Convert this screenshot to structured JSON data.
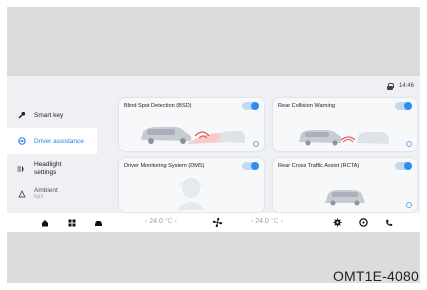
{
  "status": {
    "time": "14:46",
    "lock_icon": "lock-icon"
  },
  "sidebar": {
    "items": [
      {
        "label": "Smart key",
        "icon": "key-icon",
        "active": false
      },
      {
        "label": "Driver assistance",
        "icon": "driver-assist-icon",
        "active": true
      },
      {
        "label": "Headlight settings",
        "icon": "headlight-icon",
        "active": false
      },
      {
        "label": "Ambient",
        "sub": "light",
        "icon": "ambient-icon",
        "active": false
      }
    ]
  },
  "cards": [
    {
      "title": "Blind Spot Detection (BSD)",
      "enabled": true
    },
    {
      "title": "Rear Collision Warning",
      "enabled": true
    },
    {
      "title": "Driver Monitoring System (DMS)",
      "enabled": true
    },
    {
      "title": "Rear Cross Traffic Assist (RCTA)",
      "enabled": true
    }
  ],
  "bottombar": {
    "left_temp": "24.0",
    "right_temp": "24.0",
    "unit": "°C",
    "icons": [
      "home-icon",
      "apps-icon",
      "car-icon",
      "fan-icon",
      "settings-icon",
      "steering-icon",
      "phone-icon"
    ]
  },
  "figure_code": "OMT1E-4080",
  "colors": {
    "accent": "#2a7de1",
    "toggle_on": "#2f8cf0",
    "warning": "#e85a5a"
  }
}
